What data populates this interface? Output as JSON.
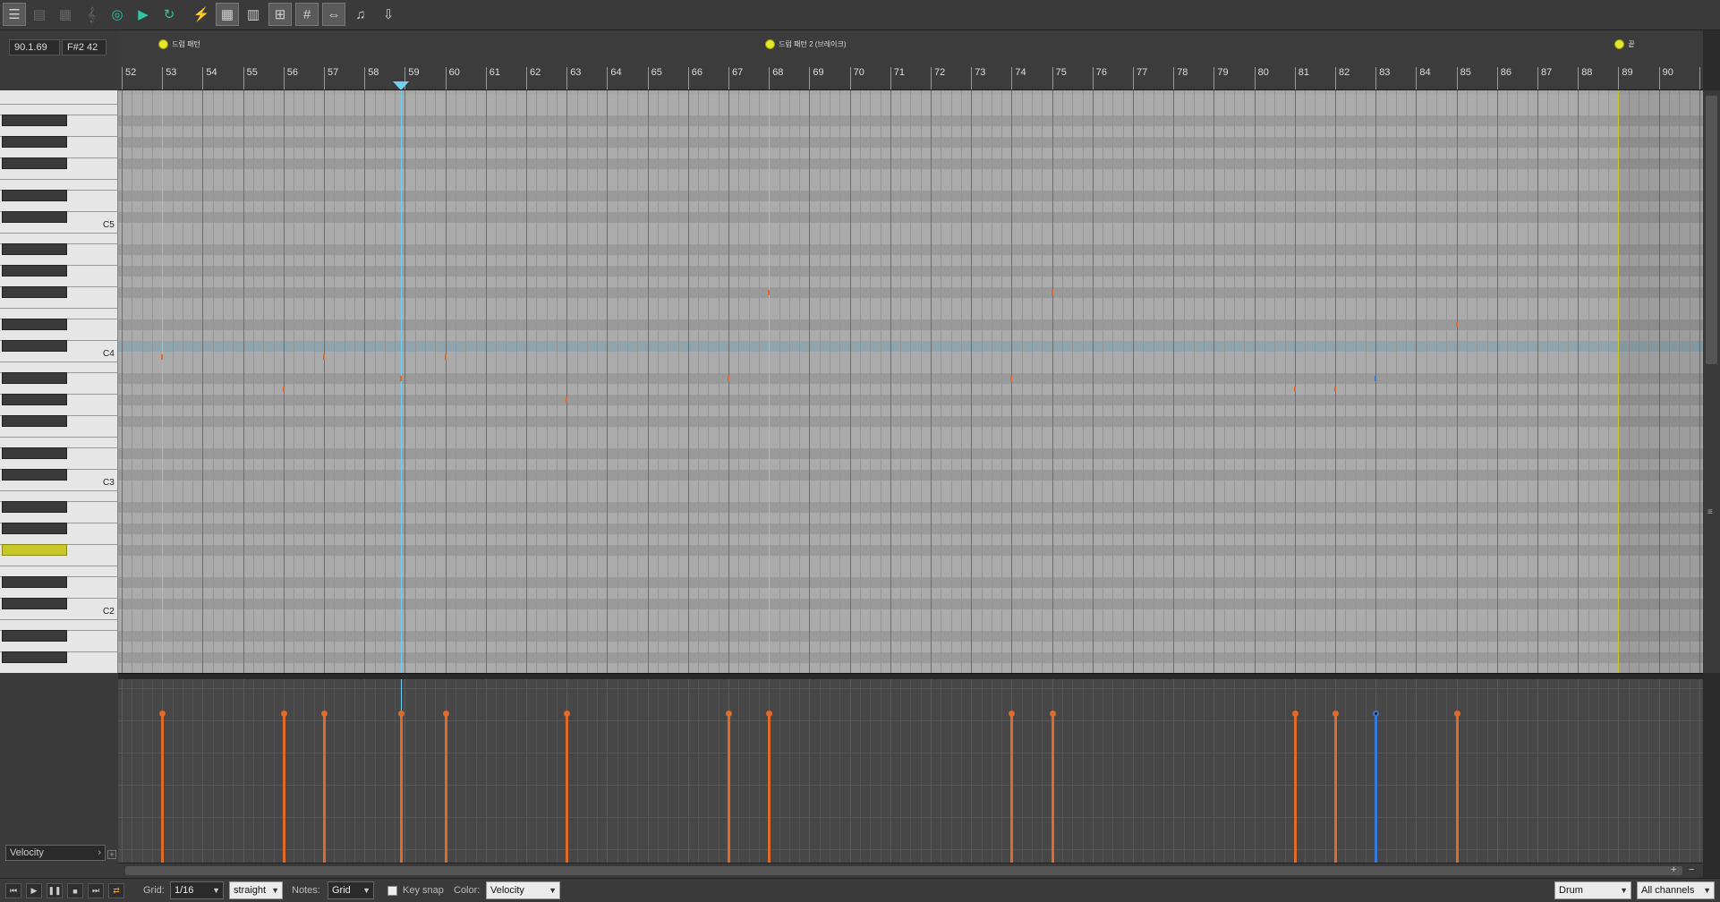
{
  "toolbar": {
    "icons": [
      "menu-icon",
      "track-list-icon",
      "event-list-icon",
      "treble-clef-icon",
      "step-record-icon",
      "play-from-icon",
      "play-sel-icon",
      "loop-icon",
      "lightning-icon",
      "grid-view-icon",
      "piano-roll-icon",
      "notation-icon",
      "grid-toggle-icon",
      "split-icon",
      "audio-icon",
      "download-icon"
    ]
  },
  "position": {
    "time": "90.1.69",
    "pitch": "F#2  42"
  },
  "ruler": {
    "bars": [
      "52",
      "53",
      "54",
      "55",
      "56",
      "57",
      "58",
      "59",
      "60",
      "61",
      "62",
      "63",
      "64",
      "65",
      "66",
      "67",
      "68",
      "69",
      "70",
      "71",
      "72",
      "73",
      "74",
      "75",
      "76",
      "77",
      "78",
      "79",
      "80",
      "81",
      "82",
      "83",
      "84",
      "85",
      "86",
      "87",
      "88",
      "89",
      "90",
      "9"
    ],
    "markers": [
      {
        "label": "드럼 패턴"
      },
      {
        "label": "드럼 패턴 2 (브레이크)"
      },
      {
        "label": "끝"
      }
    ]
  },
  "piano": {
    "labels": [
      "C5",
      "C4",
      "C3",
      "C2"
    ]
  },
  "lane": {
    "selector": "Velocity"
  },
  "bottom": {
    "grid_label": "Grid:",
    "grid_value": "1/16",
    "swing_value": "straight",
    "notes_label": "Notes:",
    "notes_value": "Grid",
    "keysnap_label": "Key snap",
    "color_label": "Color:",
    "color_value": "Velocity",
    "track_value": "Drum",
    "channel_value": "All channels"
  },
  "colors": {
    "note": "#e06a2a",
    "selected_note": "#3a78d8",
    "marker": "#e6e62a",
    "playhead": "#6fd0f0",
    "highlight_key": "#c8c828"
  },
  "notes": [
    {
      "bar": 53.0,
      "pitch": "C4"
    },
    {
      "bar": 56.0,
      "pitch": "A3"
    },
    {
      "bar": 57.0,
      "pitch": "C4"
    },
    {
      "bar": 58.9,
      "pitch": "A#3"
    },
    {
      "bar": 60.0,
      "pitch": "C4"
    },
    {
      "bar": 63.0,
      "pitch": "G#3"
    },
    {
      "bar": 67.0,
      "pitch": "A#3"
    },
    {
      "bar": 68.0,
      "pitch": "F#4"
    },
    {
      "bar": 74.0,
      "pitch": "A#3"
    },
    {
      "bar": 75.0,
      "pitch": "F#4"
    },
    {
      "bar": 81.0,
      "pitch": "A3"
    },
    {
      "bar": 82.0,
      "pitch": "A3"
    },
    {
      "bar": 83.0,
      "pitch": "A#3",
      "selected": true
    },
    {
      "bar": 85.0,
      "pitch": "D#4"
    }
  ]
}
